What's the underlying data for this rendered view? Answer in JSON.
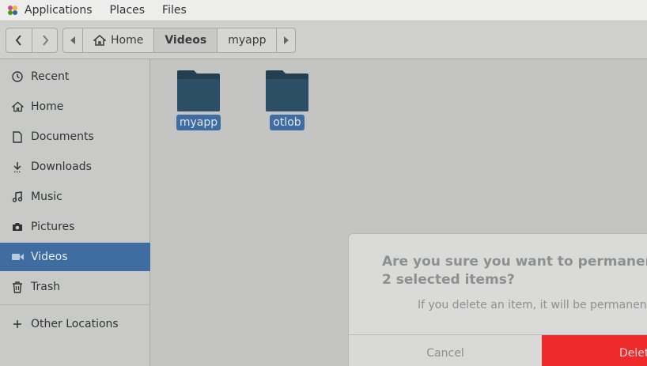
{
  "topbar": {
    "menus": [
      "Applications",
      "Places",
      "Files"
    ]
  },
  "header": {
    "path": {
      "home_label": "Home",
      "current_label": "Videos",
      "child_label": "myapp"
    }
  },
  "sidebar": {
    "items": [
      {
        "label": "Recent",
        "icon": "clock-icon"
      },
      {
        "label": "Home",
        "icon": "home-icon"
      },
      {
        "label": "Documents",
        "icon": "document-icon"
      },
      {
        "label": "Downloads",
        "icon": "download-icon"
      },
      {
        "label": "Music",
        "icon": "music-icon"
      },
      {
        "label": "Pictures",
        "icon": "camera-icon"
      },
      {
        "label": "Videos",
        "icon": "video-icon",
        "selected": true
      },
      {
        "label": "Trash",
        "icon": "trash-icon"
      }
    ],
    "other_locations": "Other Locations"
  },
  "files": [
    {
      "name": "myapp",
      "selected": true
    },
    {
      "name": "otlob",
      "selected": true
    }
  ],
  "dialog": {
    "title_line1": "Are you sure you want to permanently de",
    "title_line2": "2 selected items?",
    "subtitle": "If you delete an item, it will be permanently lo",
    "cancel_label": "Cancel",
    "delete_label": "Delet"
  },
  "colors": {
    "selection": "#3f6ca1",
    "folder": "#2d4f66",
    "destructive": "#ee2a2a"
  }
}
